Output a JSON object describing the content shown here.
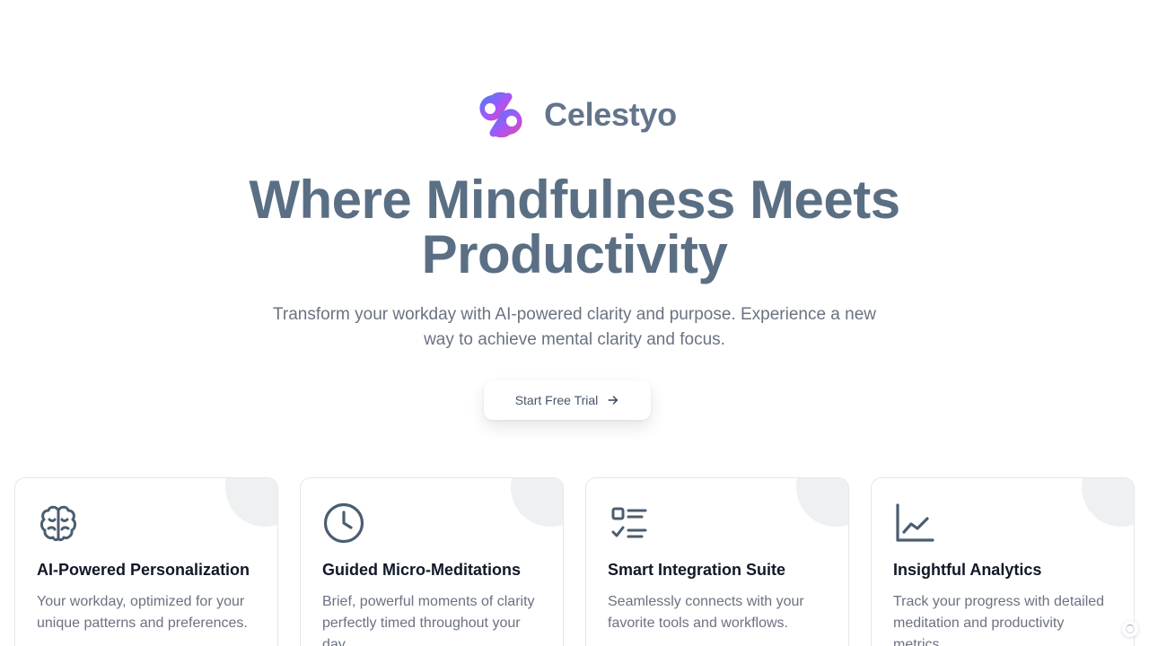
{
  "brand": {
    "name": "Celestyo",
    "logo_icon": "celestyo-logo",
    "colors": [
      "#3b82f6",
      "#a855f7",
      "#ec4899"
    ]
  },
  "hero": {
    "title_line1": "Where Mindfulness Meets",
    "title_line2": "Productivity",
    "subtitle": "Transform your workday with AI-powered clarity and purpose. Experience a new way to achieve mental clarity and focus."
  },
  "cta": {
    "label": "Start Free Trial",
    "icon": "arrow-right-icon"
  },
  "features": [
    {
      "icon": "brain-icon",
      "title": "AI-Powered Personalization",
      "description": "Your workday, optimized for your unique patterns and preferences."
    },
    {
      "icon": "clock-icon",
      "title": "Guided Micro-Meditations",
      "description": "Brief, powerful moments of clarity perfectly timed throughout your day."
    },
    {
      "icon": "checklist-icon",
      "title": "Smart Integration Suite",
      "description": "Seamlessly connects with your favorite tools and workflows."
    },
    {
      "icon": "chart-line-icon",
      "title": "Insightful Analytics",
      "description": "Track your progress with detailed meditation and productivity metrics."
    }
  ]
}
